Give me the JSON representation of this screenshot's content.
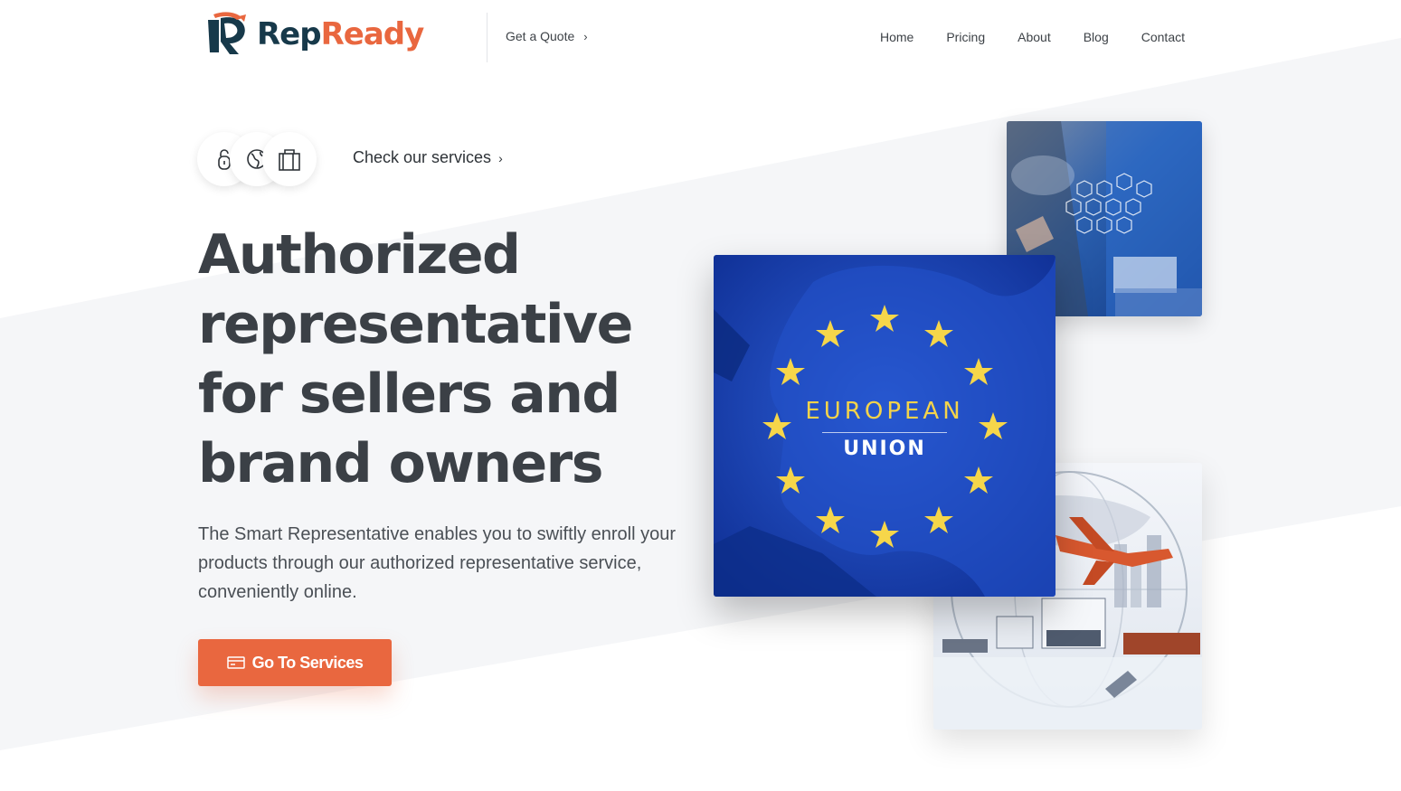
{
  "brand": {
    "name_part1": "Rep",
    "name_part2": "Ready",
    "primary_color": "#17394a",
    "accent_color": "#e9673f"
  },
  "header": {
    "quote_label": "Get a Quote",
    "nav": [
      {
        "label": "Home"
      },
      {
        "label": "Pricing"
      },
      {
        "label": "About"
      },
      {
        "label": "Blog"
      },
      {
        "label": "Contact"
      }
    ]
  },
  "services_link": {
    "label": "Check our services",
    "icons": [
      "lock-icon",
      "globe-icon",
      "shopping-bag-icon"
    ]
  },
  "hero": {
    "title": "Authorized representative for sellers and brand owners",
    "description": "The Smart Representative enables you to swiftly enroll your products through our authorized representative service, conveniently online.",
    "cta_label": "Go To Services"
  },
  "images": {
    "eu_line1": "EUROPEAN",
    "eu_line2": "UNION"
  }
}
